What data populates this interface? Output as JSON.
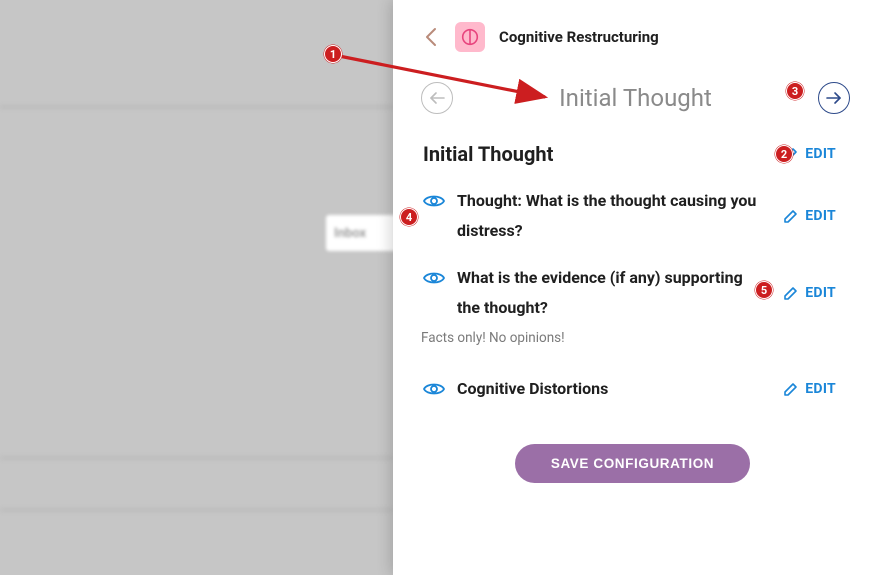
{
  "background": {
    "inbox_label": "Inbox"
  },
  "header": {
    "app_title": "Cognitive Restructuring"
  },
  "step": {
    "title": "Initial Thought"
  },
  "section": {
    "title": "Initial Thought",
    "edit_label": "EDIT"
  },
  "prompts": [
    {
      "question": "Thought: What is the thought causing you distress?",
      "edit_label": "EDIT"
    },
    {
      "question": "What is the evidence (if any) supporting the thought?",
      "hint": "Facts only! No opinions!",
      "edit_label": "EDIT"
    },
    {
      "question": "Cognitive Distortions",
      "edit_label": "EDIT"
    }
  ],
  "save_button": "SAVE CONFIGURATION",
  "annotations": {
    "1": "1",
    "2": "2",
    "3": "3",
    "4": "4",
    "5": "5"
  },
  "colors": {
    "accent_blue": "#1a86d8",
    "nav_outline": "#2d4a8a",
    "save_purple": "#9b6fa7",
    "anno_red": "#cc1e20",
    "icon_pink_bg": "#ffb9cc",
    "icon_pink_fg": "#e8457e"
  }
}
